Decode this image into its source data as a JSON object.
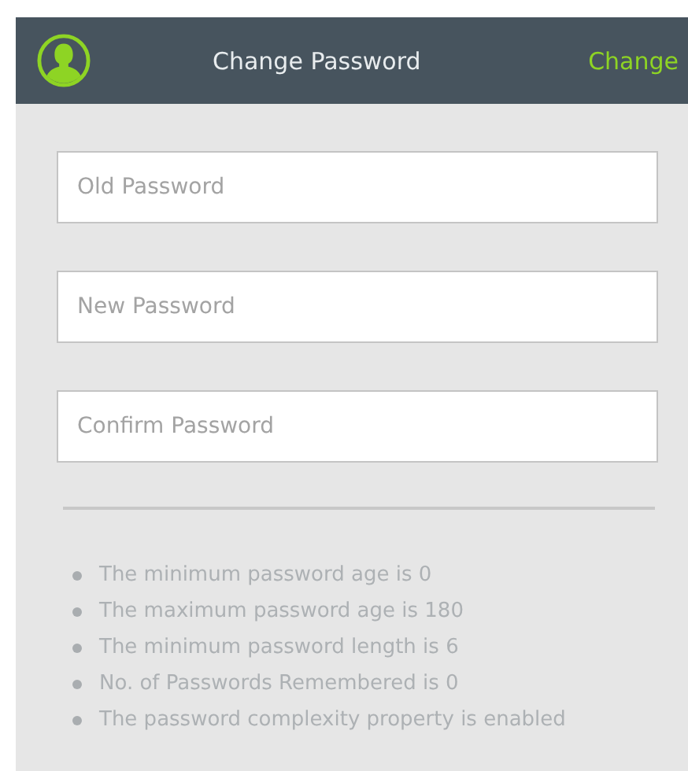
{
  "header": {
    "title": "Change Password",
    "action": "Change"
  },
  "fields": [
    {
      "placeholder": "Old Password"
    },
    {
      "placeholder": "New Password"
    },
    {
      "placeholder": "Confirm Password"
    }
  ],
  "rules": [
    "The minimum password age is 0",
    "The maximum password age is 180",
    "The minimum password length is 6",
    "No. of Passwords Remembered is 0",
    "The password complexity property is enabled"
  ]
}
